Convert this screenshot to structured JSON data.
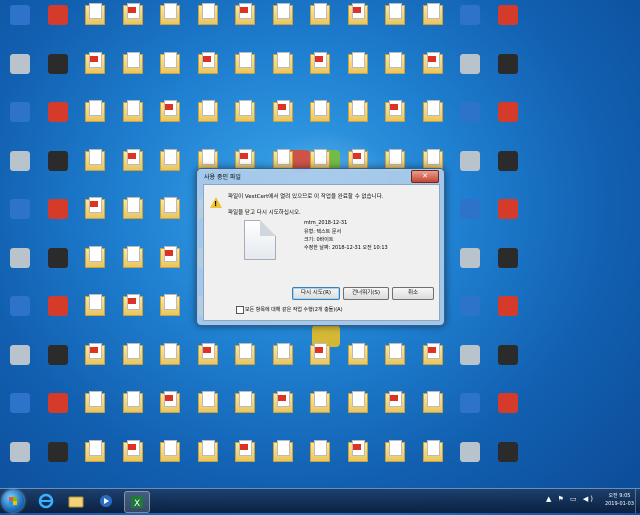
{
  "dialog": {
    "title": "사용 중인 파일",
    "message": "파일이 VestCert에서 열려 있으므로 이 작업을 완료할 수 없습니다.",
    "instruction": "파일을 닫고 다시 시도하십시오.",
    "file": {
      "name": "mtm_2018-12-31",
      "type": "유형: 텍스트 문서",
      "size": "크기: 0바이트",
      "modified": "수정한 날짜: 2018-12-31 오전 10:13"
    },
    "buttons": {
      "retry": "다시 시도(R)",
      "skip": "건너뛰기(S)",
      "cancel": "취소"
    },
    "checkbox_label": "모든 항목에 대해 같은 작업 수행(2개 충돌)(A)",
    "close_glyph": "✕"
  },
  "taskbar": {
    "clock_time": "오전 9:05",
    "clock_date": "2019-01-03",
    "tray": "▲ ⚑ ▭ ◀)"
  },
  "colors": {
    "dialog_frame": "#afcdeb",
    "warning": "#f1c232",
    "close": "#c64432"
  }
}
